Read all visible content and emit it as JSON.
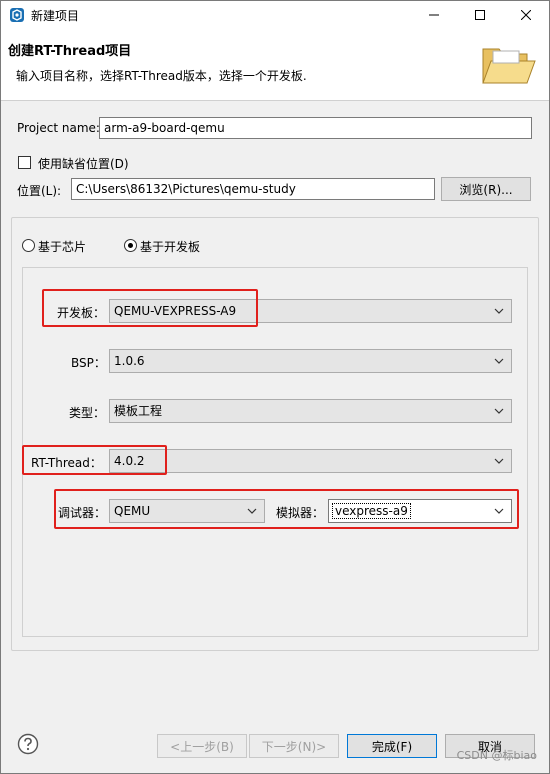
{
  "window": {
    "title": "新建项目"
  },
  "banner": {
    "title": "创建RT-Thread项目",
    "description": "输入项目名称，选择RT-Thread版本，选择一个开发板."
  },
  "project": {
    "name_label": "Project name:",
    "name_value": "arm-a9-board-qemu",
    "default_location_label": "使用缺省位置(D)",
    "default_location_checked": false,
    "location_label": "位置(L):",
    "location_value": "C:\\Users\\86132\\Pictures\\qemu-study",
    "browse_label": "浏览(R)..."
  },
  "mode": {
    "chip_label": "基于芯片",
    "board_label": "基于开发板",
    "selected": "board"
  },
  "config": {
    "board_label": "开发板：",
    "board_value": "QEMU-VEXPRESS-A9",
    "bsp_label": "BSP：",
    "bsp_value": "1.0.6",
    "type_label": "类型：",
    "type_value": "模板工程",
    "rtthread_label": "RT-Thread：",
    "rtthread_value": "4.0.2",
    "debugger_label": "调试器：",
    "debugger_value": "QEMU",
    "emulator_label": "模拟器：",
    "emulator_value": "vexpress-a9"
  },
  "footer": {
    "back_label": "<上一步(B)",
    "next_label": "下一步(N)>",
    "finish_label": "完成(F)",
    "cancel_label": "取消"
  },
  "watermark": "CSDN @标biao",
  "colors": {
    "highlight": "#e0201c",
    "accent": "#0078d7"
  }
}
